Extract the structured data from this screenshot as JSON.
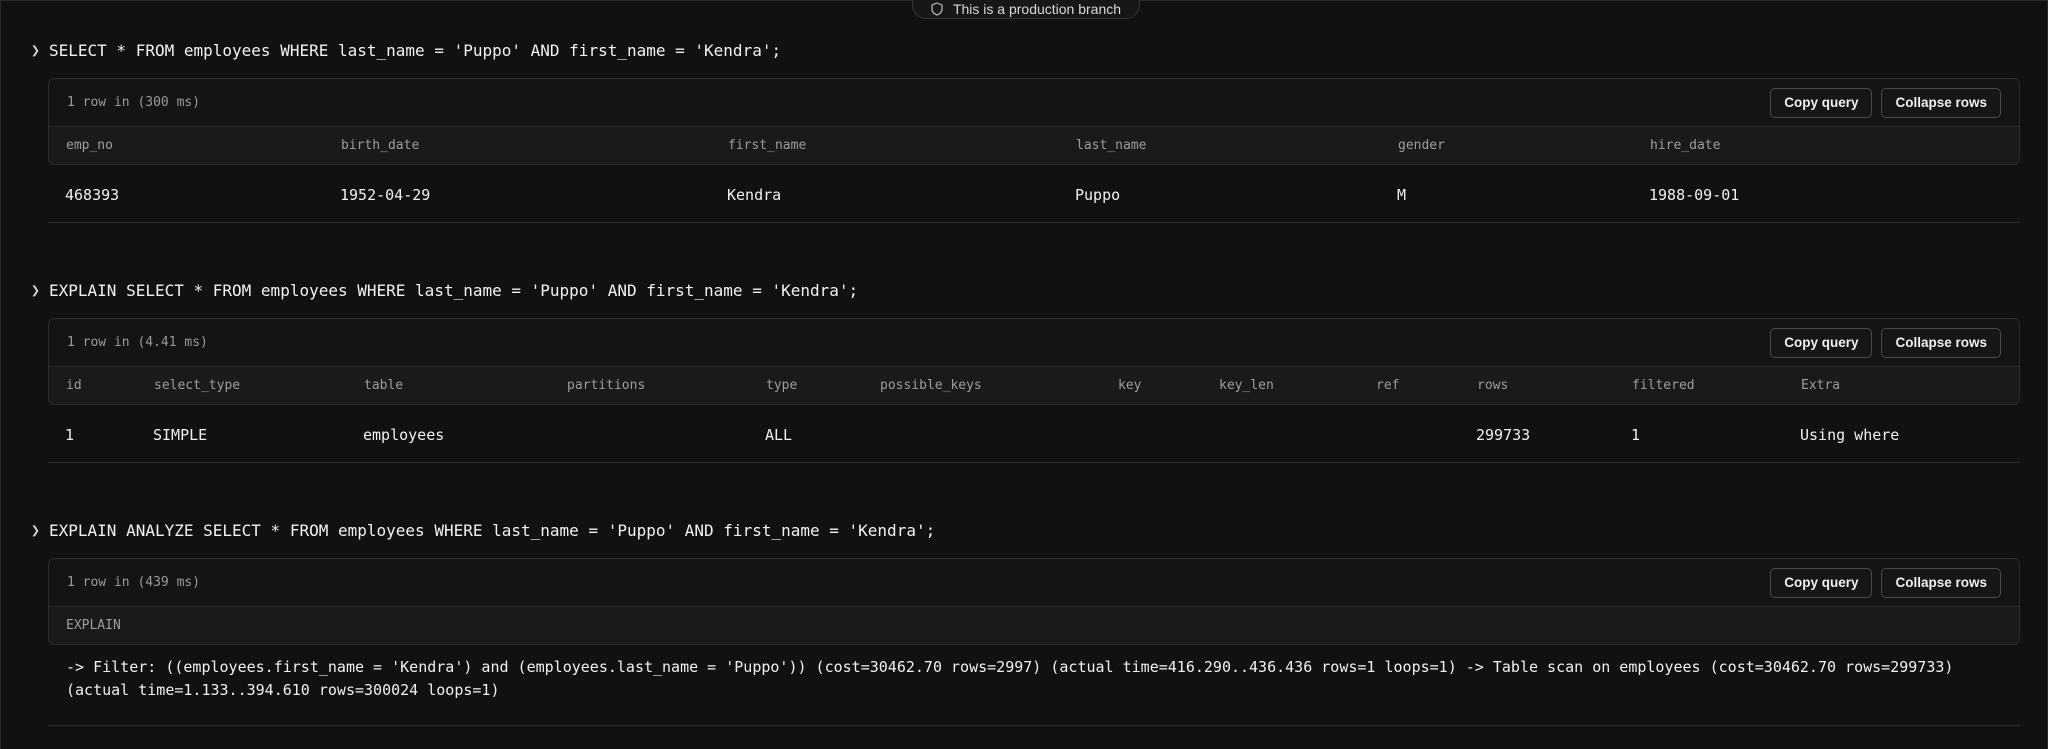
{
  "banner": {
    "text": "This is a production branch",
    "icon": "shield-icon"
  },
  "queries": [
    {
      "sql": "SELECT * FROM employees WHERE last_name = 'Puppo' AND first_name = 'Kendra';",
      "meta": "1 row in (300 ms)",
      "copy_label": "Copy query",
      "collapse_label": "Collapse rows",
      "columns": [
        "emp_no",
        "birth_date",
        "first_name",
        "last_name",
        "gender",
        "hire_date"
      ],
      "rows": [
        [
          "468393",
          "1952-04-29",
          "Kendra",
          "Puppo",
          "M",
          "1988-09-01"
        ]
      ]
    },
    {
      "sql": "EXPLAIN SELECT * FROM employees WHERE last_name = 'Puppo' AND first_name = 'Kendra';",
      "meta": "1 row in (4.41 ms)",
      "copy_label": "Copy query",
      "collapse_label": "Collapse rows",
      "columns": [
        "id",
        "select_type",
        "table",
        "partitions",
        "type",
        "possible_keys",
        "key",
        "key_len",
        "ref",
        "rows",
        "filtered",
        "Extra"
      ],
      "rows": [
        [
          "1",
          "SIMPLE",
          "employees",
          "",
          "ALL",
          "",
          "",
          "",
          "",
          "299733",
          "1",
          "Using where"
        ]
      ]
    },
    {
      "sql": "EXPLAIN ANALYZE SELECT * FROM employees WHERE last_name = 'Puppo' AND first_name = 'Kendra';",
      "meta": "1 row in (439 ms)",
      "copy_label": "Copy query",
      "collapse_label": "Collapse rows",
      "columns": [
        "EXPLAIN"
      ],
      "rows": [
        [
          "-> Filter: ((employees.first_name = 'Kendra') and (employees.last_name = 'Puppo')) (cost=30462.70 rows=2997) (actual time=416.290..436.436 rows=1 loops=1) -> Table scan on employees (cost=30462.70 rows=299733) (actual time=1.133..394.610 rows=300024 loops=1)"
        ]
      ]
    }
  ]
}
